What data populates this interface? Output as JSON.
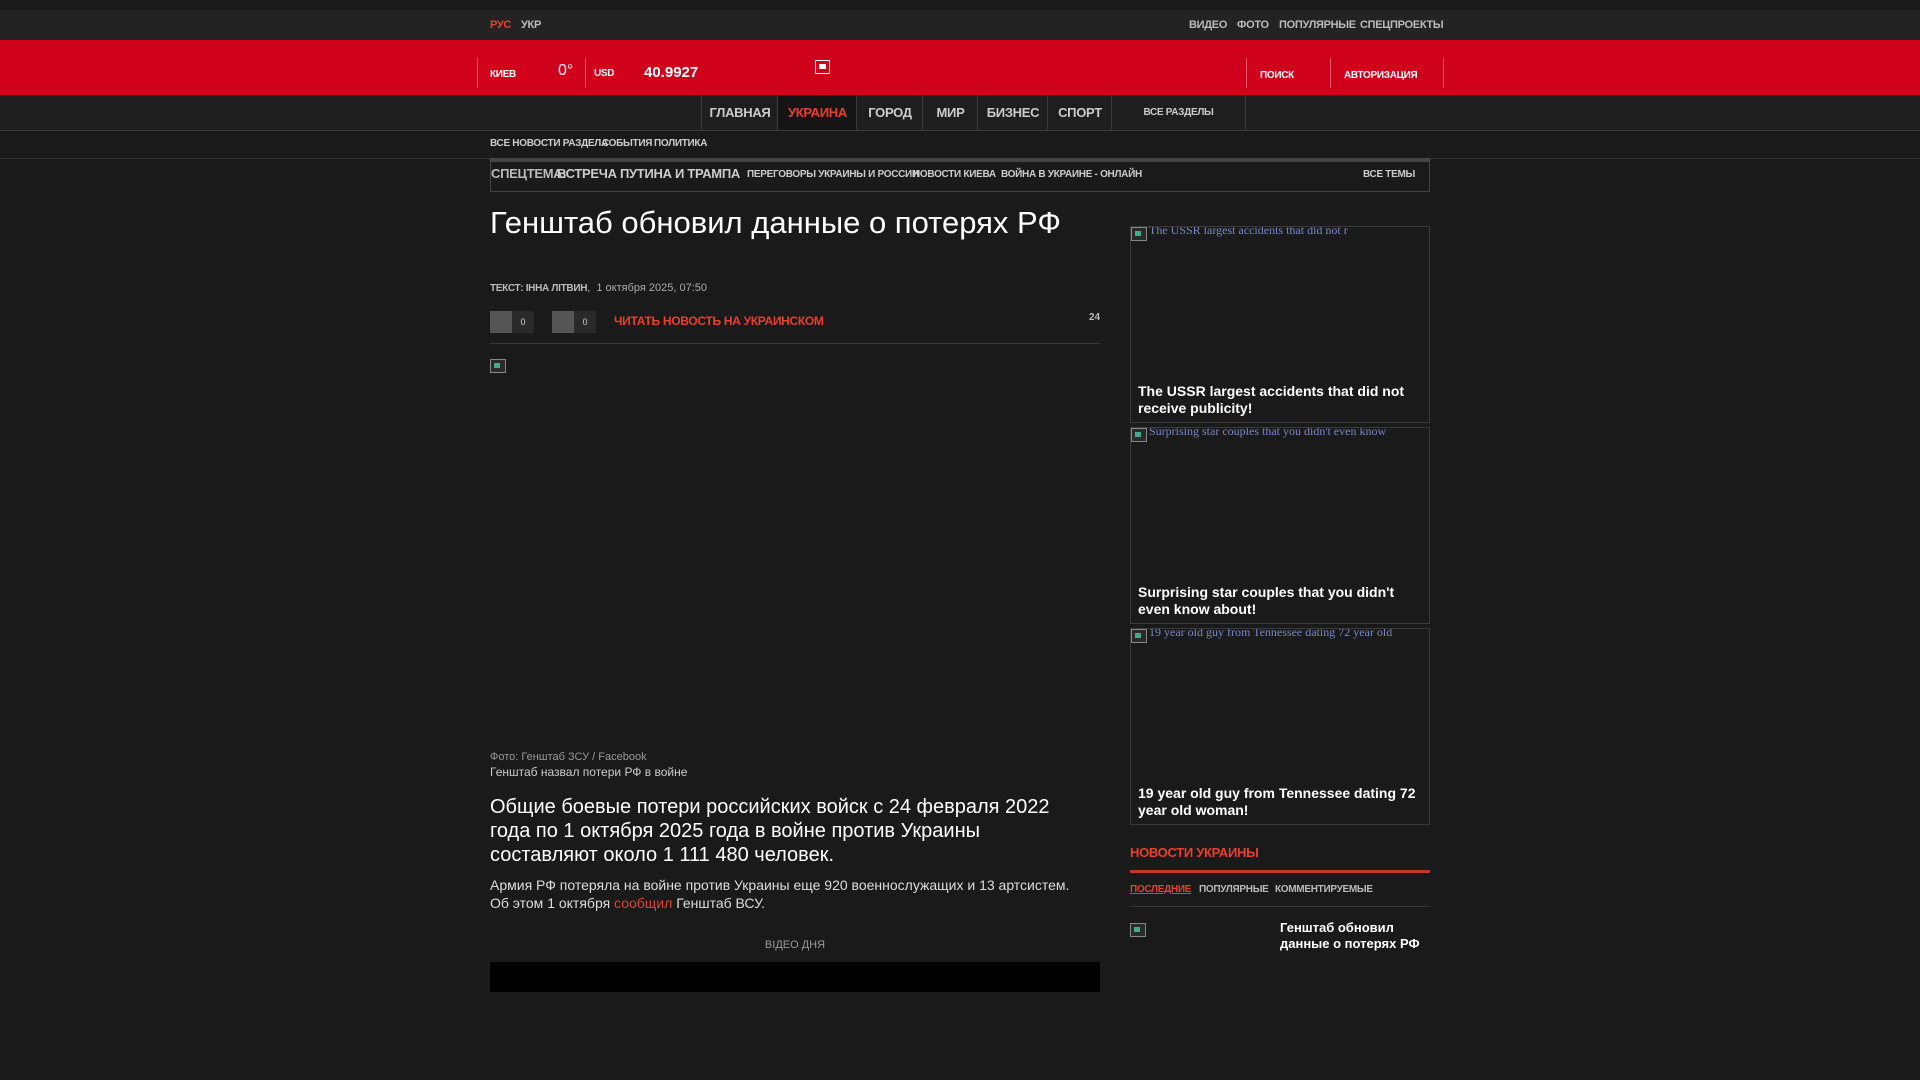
{
  "topbar": {
    "lang_ru": "РУС",
    "lang_ua": "УКР",
    "links": [
      "ВИДЕО",
      "ФОТО",
      "ПОПУЛЯРНЫЕ",
      "СПЕЦПРОЕКТЫ"
    ]
  },
  "header": {
    "city": "КИЕВ",
    "temperature": "0°",
    "currency": "USD",
    "rate": "40.9927",
    "search": "ПОИСК",
    "login": "АВТОРИЗАЦИЯ"
  },
  "nav": {
    "items": [
      "ГЛАВНАЯ",
      "УКРАИНА",
      "ГОРОД",
      "МИР",
      "БИЗНЕС",
      "СПОРТ"
    ],
    "all_sections": "ВСЕ РАЗДЕЛЫ"
  },
  "subnav": {
    "all_news": "ВСЕ НОВОСТИ РАЗДЕЛА",
    "events": "СОБЫТИЯ",
    "politics": "ПОЛИТИКА"
  },
  "spec": {
    "label": "СПЕЦТЕМА:",
    "topic": "ВСТРЕЧА ПУТИНА И ТРАМПА",
    "links": [
      "ПЕРЕГОВОРЫ УКРАИНЫ И РОССИИ",
      "НОВОСТИ КИЕВА",
      "ВОЙНА В УКРАИНЕ - ОНЛАЙН"
    ],
    "all_topics": "ВСЕ ТЕМЫ"
  },
  "article": {
    "title": "Генштаб обновил данные о потерях РФ",
    "author": "ТЕКСТ: ІННА ЛІТВИН",
    "date": "1 октября 2025, 07:50",
    "share_count_1": "0",
    "share_count_2": "0",
    "read_ua": "ЧИТАТЬ НОВОСТЬ НА УКРАИНСКОМ",
    "views": "24",
    "photo_credit": "Фото: Генштаб ЗСУ / Facebook",
    "photo_caption": "Генштаб назвал потери РФ в войне",
    "lead": "Общие боевые потери российских войск с 24 февраля 2022 года по 1 октября 2025 года в войне против Украины составляют около 1 111 480 человек.",
    "body_before": "Армия РФ потеряла на войне против Украины еще 920 военнослужащих и 13 артсистем. Об этом 1 октября ",
    "body_link": "сообщил",
    "body_after": " Генштаб ВСУ.",
    "video_label": "ВІДЕО ДНЯ"
  },
  "sidebar": {
    "cards": [
      {
        "alt": "The USSR largest accidents that did not r",
        "title": "The USSR largest accidents that did not receive publicity!"
      },
      {
        "alt": "Surprising star couples that you didn't even know",
        "title": "Surprising star couples that you didn't even know about!"
      },
      {
        "alt": "19 year old guy from Tennessee dating 72 year old",
        "title": "19 year old guy from Tennessee dating 72 year old woman!"
      }
    ],
    "news_heading": "НОВОСТИ УКРАИНЫ",
    "tabs": [
      "ПОСЛЕДНИЕ",
      "ПОПУЛЯРНЫЕ",
      "КОММЕНТИРУЕМЫЕ"
    ],
    "news_item": "Генштаб обновил данные о потерях РФ"
  },
  "colors": {
    "brand_red": "#d0021b",
    "accent_link": "#e8402f"
  }
}
